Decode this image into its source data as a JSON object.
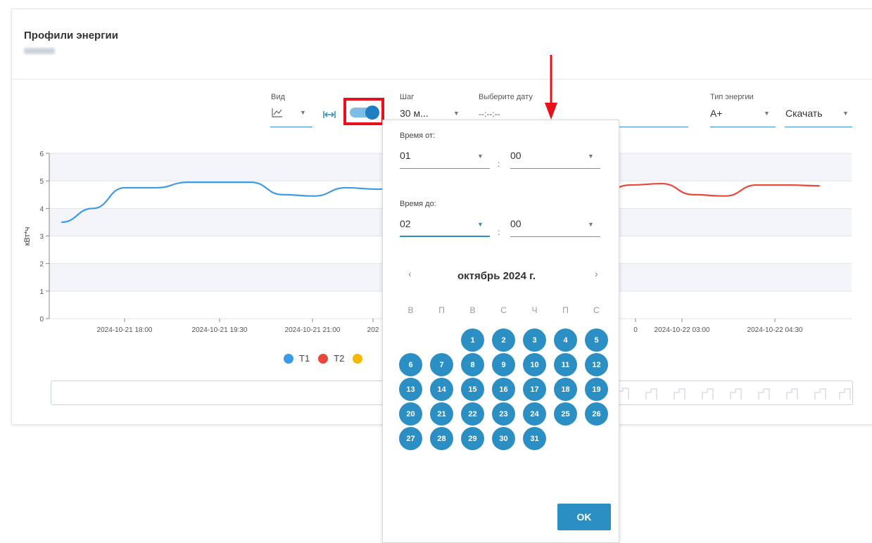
{
  "card": {
    "title": "Профили энергии"
  },
  "toolbar": {
    "view_label": "Вид",
    "step_label": "Шаг",
    "step_value": "30 м...",
    "date_label": "Выберите дату",
    "date_value": "--:--:--",
    "energy_type_label": "Тип энергии",
    "energy_type_value": "А+",
    "download_label": "Скачать"
  },
  "chart_data": {
    "type": "line",
    "ylabel": "кВт*ч",
    "ylim": [
      0,
      6
    ],
    "y_ticks": [
      "0",
      "1",
      "2",
      "3",
      "4",
      "5",
      "6"
    ],
    "x_tick_labels": [
      "2024-10-21 18:00",
      "2024-10-21 19:30",
      "2024-10-21 21:00",
      "202",
      "0",
      "2024-10-22 03:00",
      "2024-10-22 04:30"
    ],
    "series": [
      {
        "name": "T1",
        "color": "#3b9be8",
        "x": [
          "17:00",
          "17:30",
          "18:00",
          "18:30",
          "19:00",
          "19:30",
          "20:00",
          "20:30",
          "21:00",
          "21:30",
          "22:00",
          "22:30"
        ],
        "values": [
          3.5,
          4.0,
          4.75,
          4.75,
          4.95,
          4.95,
          4.95,
          4.5,
          4.45,
          4.75,
          4.7,
          4.75
        ]
      },
      {
        "name": "T2",
        "color": "#e8473b",
        "x": [
          "01:30",
          "02:00",
          "02:30",
          "03:00",
          "03:30",
          "04:00",
          "04:30",
          "05:00"
        ],
        "values": [
          4.5,
          4.85,
          4.9,
          4.5,
          4.45,
          4.85,
          4.85,
          4.82
        ]
      }
    ],
    "legend": [
      {
        "name": "T1",
        "color": "#3b9be8"
      },
      {
        "name": "T2",
        "color": "#e8473b"
      },
      {
        "name": "",
        "color": "#f5b800"
      }
    ]
  },
  "popup": {
    "time_from_label": "Время от:",
    "time_from_hour": "01",
    "time_from_min": "00",
    "time_to_label": "Время до:",
    "time_to_hour": "02",
    "time_to_min": "00",
    "separator": ":",
    "month_title": "октябрь 2024 г.",
    "prev": "‹",
    "next": "›",
    "weekdays": [
      "В",
      "П",
      "В",
      "С",
      "Ч",
      "П",
      "С"
    ],
    "first_day_col": 2,
    "days": [
      "1",
      "2",
      "3",
      "4",
      "5",
      "6",
      "7",
      "8",
      "9",
      "10",
      "11",
      "12",
      "13",
      "14",
      "15",
      "16",
      "17",
      "18",
      "19",
      "20",
      "21",
      "22",
      "23",
      "24",
      "25",
      "26",
      "27",
      "28",
      "29",
      "30",
      "31"
    ],
    "ok_label": "OK"
  },
  "annotation_colors": {
    "highlight": "#e8101a",
    "arrow": "#e8101a"
  },
  "icons": [
    "line-chart-icon",
    "fit-width-icon",
    "toggle-switch",
    "caret-down-icon",
    "down-arrow-annotation"
  ]
}
